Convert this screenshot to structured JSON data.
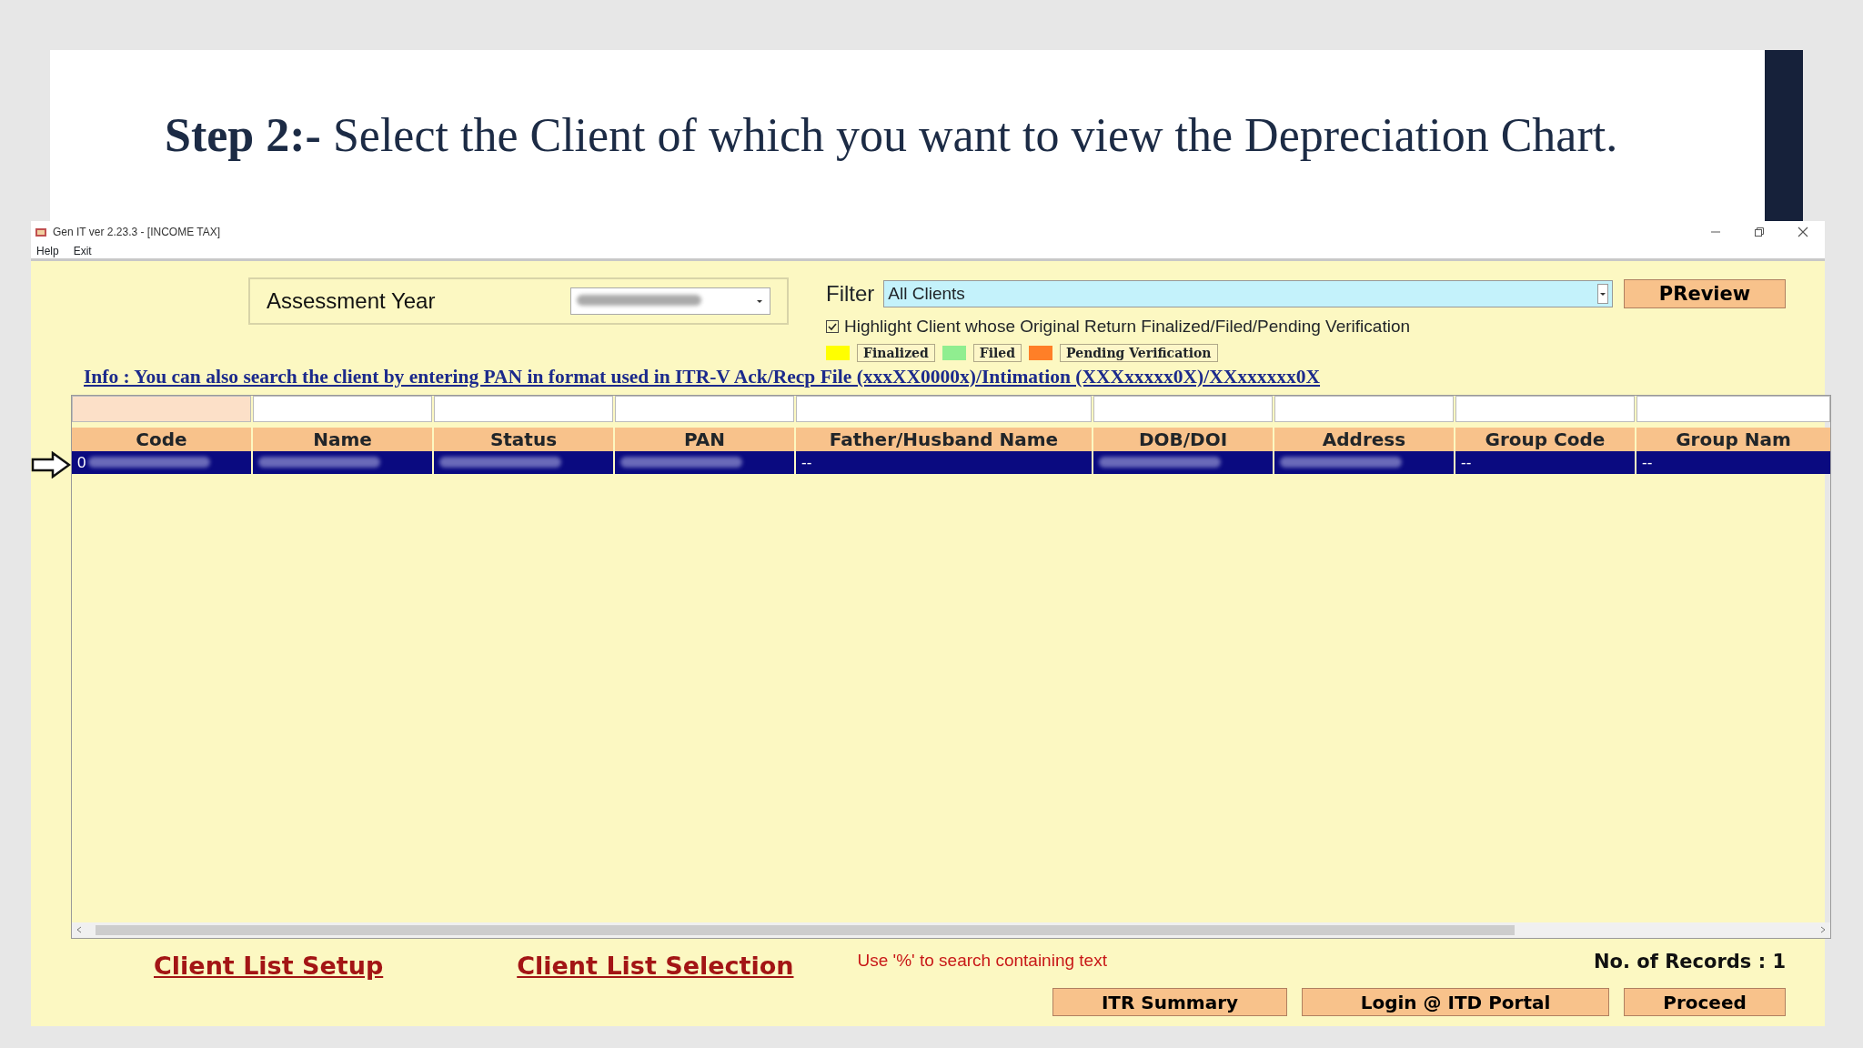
{
  "slide": {
    "heading": "**Step 2:-** Select the Client of which you want to view the Depreciation Chart."
  },
  "window": {
    "title": "Gen IT ver 2.23.3 - [INCOME TAX]"
  },
  "menu": [
    "Help",
    "Exit"
  ],
  "assessment": {
    "label": "Assessment Year",
    "value_blurred": true
  },
  "filter": {
    "label": "Filter",
    "value": "All Clients"
  },
  "preview_button": "PReview",
  "highlight": {
    "label": "Highlight Client whose Original Return Finalized/Filed/Pending Verification",
    "checked": true
  },
  "legend": [
    {
      "label": "Finalized",
      "color": "#ffff00"
    },
    {
      "label": "Filed",
      "color": "#90ee90"
    },
    {
      "label": "Pending Verification",
      "color": "#ff7f27"
    }
  ],
  "info": "Info : You can also search the client by entering PAN in format used in ITR-V Ack/Recp File (xxxXX0000x)/Intimation (XXXxxxxx0X)/XXxxxxxx0X",
  "table": {
    "filters": [
      {
        "selected": true
      },
      {
        "selected": false
      },
      {
        "selected": false
      },
      {
        "selected": false
      },
      {
        "selected": false
      },
      {
        "selected": false
      },
      {
        "selected": false
      },
      {
        "selected": false
      },
      {
        "selected": false
      }
    ],
    "columns": [
      "Code",
      "Name",
      "Status",
      "PAN",
      "Father/Husband Name",
      "DOB/DOI",
      "Address",
      "Group Code",
      "Group Nam"
    ],
    "rows": [
      {
        "selected": true,
        "cells": [
          {
            "text": "0",
            "blurred": true
          },
          {
            "blurred": true
          },
          {
            "blurred": true
          },
          {
            "blurred": true
          },
          {
            "text": "--",
            "blurred": false
          },
          {
            "blurred": true
          },
          {
            "blurred": true
          },
          {
            "text": "--",
            "blurred": false
          },
          {
            "text": "--",
            "blurred": false
          }
        ]
      }
    ]
  },
  "bottom": {
    "links": [
      "Client List Setup",
      "Client List Selection"
    ],
    "hint": "Use '%'  to search containing text",
    "records": "No. of Records : 1",
    "buttons": [
      "ITR Summary",
      "Login @ ITD Portal",
      "Proceed"
    ]
  }
}
